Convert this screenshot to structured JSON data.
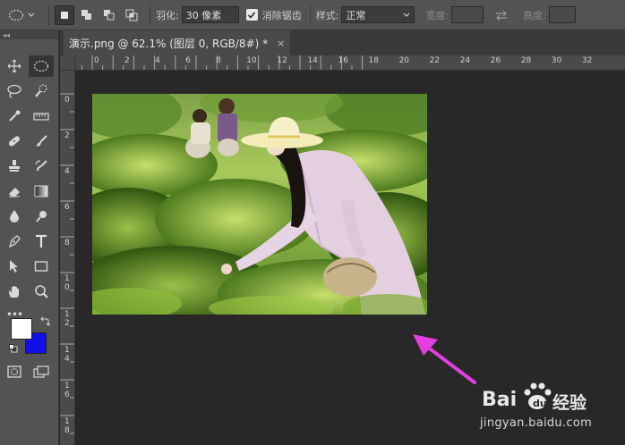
{
  "options_bar": {
    "feather_label": "羽化:",
    "feather_value": "30 像素",
    "antialias_label": "消除锯齿",
    "style_label": "样式:",
    "style_value": "正常",
    "width_label": "宽度:",
    "height_label": "高度:"
  },
  "document": {
    "tab_title": "演示.png @ 62.1% (图层 0, RGB/8#) *",
    "close_label": "×"
  },
  "ruler": {
    "h_labels": [
      "0",
      "2",
      "4",
      "6",
      "8",
      "10",
      "12",
      "14",
      "16",
      "18",
      "20",
      "22",
      "24",
      "26",
      "28",
      "30",
      "32"
    ],
    "v_labels": [
      "0",
      "2",
      "4",
      "6",
      "8",
      "10",
      "12",
      "14",
      "16",
      "18"
    ]
  },
  "toolbox": {
    "collapse_label": "◂◂",
    "more_label": "•••"
  },
  "colors": {
    "foreground": "#ffffff",
    "background": "#1010e8",
    "annotation_arrow": "#e23ee0"
  },
  "watermark": {
    "brand": "Bai",
    "brand_suffix": "经验",
    "url": "jingyan.baidu.com"
  }
}
